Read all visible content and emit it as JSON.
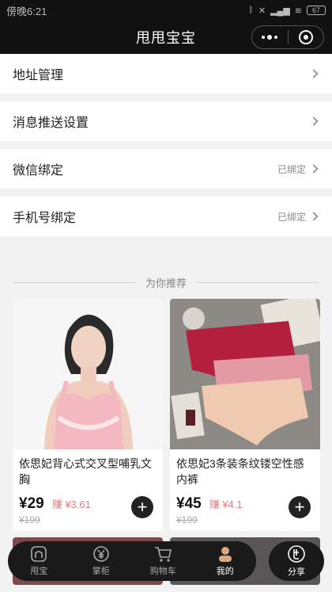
{
  "statusbar": {
    "time": "傍晚6:21",
    "battery": "67"
  },
  "navbar": {
    "title": "甩甩宝宝"
  },
  "settings": [
    {
      "label": "地址管理",
      "status": ""
    },
    {
      "label": "消息推送设置",
      "status": ""
    },
    {
      "label": "微信绑定",
      "status": "已绑定"
    },
    {
      "label": "手机号绑定",
      "status": "已绑定"
    }
  ],
  "recommend": {
    "title": "为你推荐",
    "products": [
      {
        "name": "依思妃背心式交叉型哺乳文胸",
        "price": "¥29",
        "earn": "赚 ¥3.61",
        "original": "¥199"
      },
      {
        "name": "依思妃3条装条纹镂空性感内裤",
        "price": "¥45",
        "earn": "赚 ¥4.1",
        "original": "¥199"
      }
    ]
  },
  "tabbar": {
    "tabs": [
      {
        "label": "甩宝",
        "icon": "home-icon"
      },
      {
        "label": "掌柜",
        "icon": "yen-coin-icon"
      },
      {
        "label": "购物车",
        "icon": "cart-icon"
      },
      {
        "label": "我的",
        "icon": "user-icon"
      }
    ],
    "share": {
      "label": "分享",
      "icon": "share-icon"
    }
  },
  "colors": {
    "bar": "#111111",
    "earn": "#e07a7a",
    "background": "#f2f2f2"
  }
}
